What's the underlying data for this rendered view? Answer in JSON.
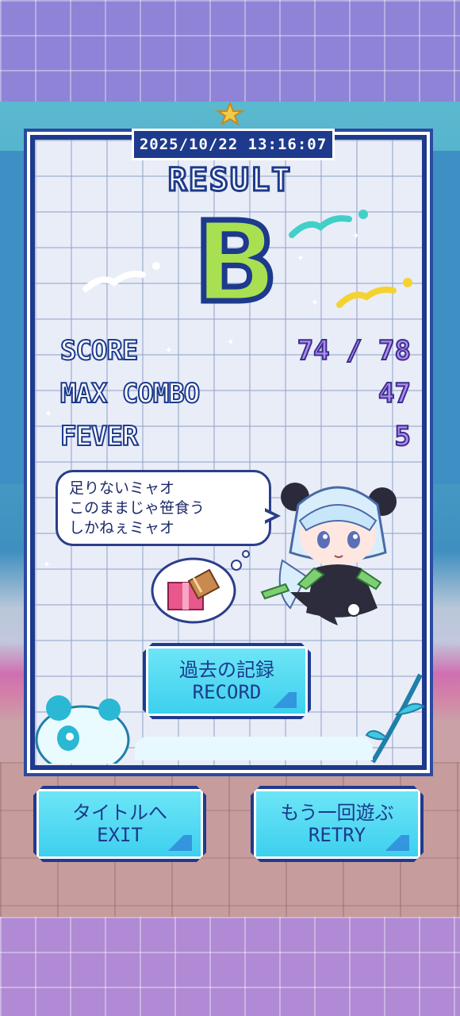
{
  "result": {
    "datetime": "2025/10/22 13:16:07",
    "title": "RESULT",
    "grade": "B"
  },
  "stats": [
    {
      "label": "SCORE",
      "value": "74 / 78"
    },
    {
      "label": "MAX COMBO",
      "value": "47"
    },
    {
      "label": "FEVER",
      "value": "5"
    }
  ],
  "speech": {
    "lines": [
      "足りないミャオ",
      "このままじゃ笹食う",
      "しかねぇミャオ"
    ]
  },
  "buttons": {
    "record": {
      "jp": "過去の記録",
      "en": "RECORD"
    },
    "exit": {
      "jp": "タイトルへ",
      "en": "EXIT"
    },
    "retry": {
      "jp": "もう一回遊ぶ",
      "en": "RETRY"
    }
  },
  "colors": {
    "panel_border": "#1d3a8c",
    "grade_fill": "#a8e052",
    "stat_value": "#b38bf0",
    "button_fill": "#3bcfee"
  },
  "icons": [
    "panda-girl-character",
    "thought-bubble-gift-icon",
    "sparkle-icon",
    "bamboo-leaf-icon",
    "panda-face-icon",
    "bird-icon"
  ]
}
